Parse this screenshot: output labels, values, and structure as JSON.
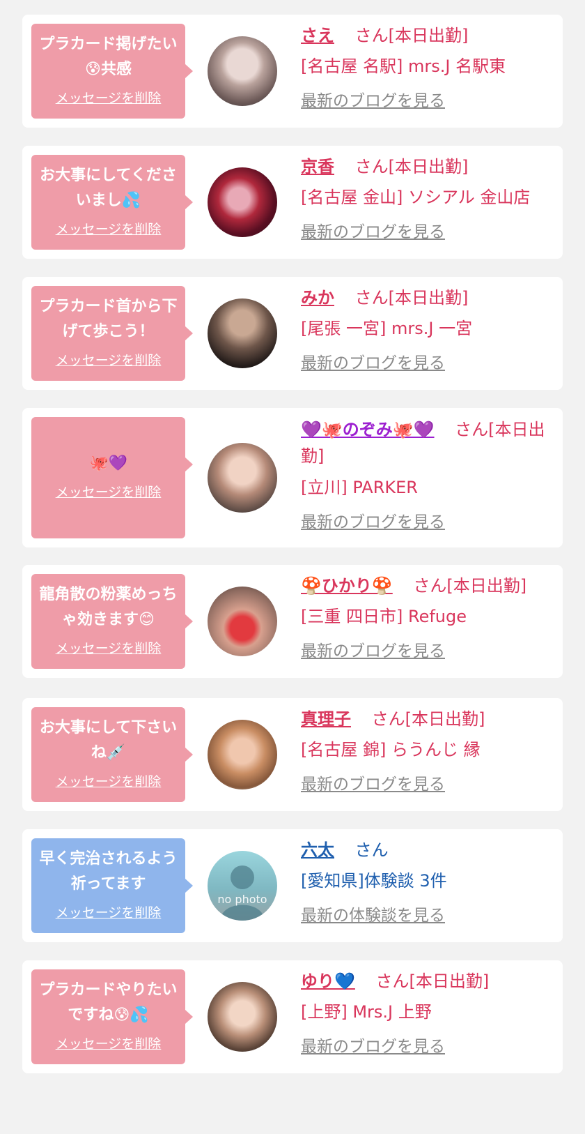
{
  "delete_label": "メッセージを削除",
  "colors": {
    "pink_bubble": "#ef9ca8",
    "blue_bubble": "#8fb5ec",
    "name_red": "#d9365c",
    "name_blue": "#1f5fae",
    "link_gray": "#8a8a8a"
  },
  "cards": [
    {
      "message": "プラカード掲げたい😰共感",
      "name": "さえ",
      "suffix": "さん[本日出勤]",
      "shop": "[名古屋 名駅] mrs.J 名駅東",
      "link": "最新のブログを見る"
    },
    {
      "message": "お大事にしてくださいまし💦",
      "name": "京香",
      "suffix": "さん[本日出勤]",
      "shop": "[名古屋 金山] ソシアル 金山店",
      "link": "最新のブログを見る"
    },
    {
      "message": "プラカード首から下げて歩こう！",
      "name": "みか",
      "suffix": "さん[本日出勤]",
      "shop": "[尾張 一宮] mrs.J 一宮",
      "link": "最新のブログを見る"
    },
    {
      "message": "🐙💜",
      "name": "💜🐙のぞみ🐙💜",
      "suffix": "さん[本日出勤]",
      "shop": "[立川] PARKER",
      "link": "最新のブログを見る"
    },
    {
      "message": "龍角散の粉薬めっちゃ効きます😊",
      "name": "🍄ひかり🍄",
      "suffix": "さん[本日出勤]",
      "shop": "[三重 四日市] Refuge",
      "link": "最新のブログを見る"
    },
    {
      "message": "お大事にして下さいね💉",
      "name": "真理子",
      "suffix": "さん[本日出勤]",
      "shop": "[名古屋 錦] らうんじ 縁",
      "link": "最新のブログを見る"
    },
    {
      "message": "早く完治されるよう祈ってます",
      "name": "六太",
      "suffix": "さん",
      "shop": "[愛知県]体験談 3件",
      "link": "最新の体験談を見る",
      "avatar_text": "no photo"
    },
    {
      "message": "プラカードやりたいですね😰💦",
      "name": "ゆり💙",
      "suffix": "さん[本日出勤]",
      "shop": "[上野] Mrs.J 上野",
      "link": "最新のブログを見る"
    }
  ]
}
